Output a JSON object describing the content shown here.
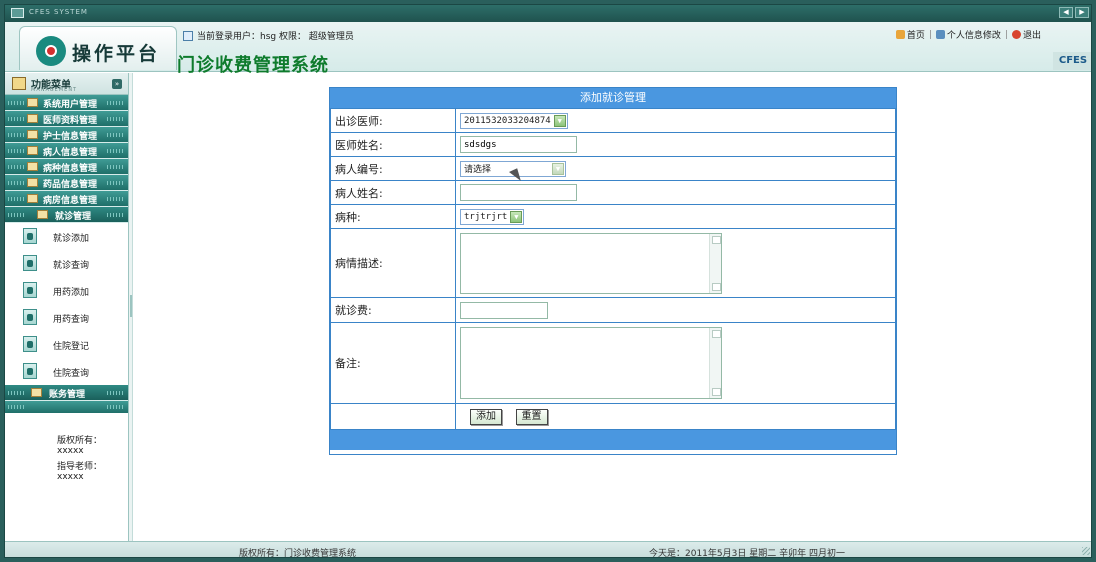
{
  "window": {
    "title": "CFES SYSTEM"
  },
  "header": {
    "logo_text": "操作平台",
    "system_title": "门诊收费管理系统",
    "user_label": "当前登录用户：hsg 权限： 超级管理员",
    "nav": {
      "home": "首页",
      "profile": "个人信息修改",
      "logout": "退出",
      "sep": "|"
    },
    "brand": "CFES"
  },
  "sidebar": {
    "menu_title": "功能菜单",
    "menu_subtitle": "MANAGEMENT",
    "groups": [
      {
        "label": "系统用户管理"
      },
      {
        "label": "医师资料管理"
      },
      {
        "label": "护士信息管理"
      },
      {
        "label": "病人信息管理"
      },
      {
        "label": "病种信息管理"
      },
      {
        "label": "药品信息管理"
      },
      {
        "label": "病房信息管理"
      }
    ],
    "active_group": "就诊管理",
    "sub_items": [
      {
        "label": "就诊添加"
      },
      {
        "label": "就诊查询"
      },
      {
        "label": "用药添加"
      },
      {
        "label": "用药查询"
      },
      {
        "label": "住院登记"
      },
      {
        "label": "住院查询"
      }
    ],
    "account_group": "账务管理",
    "copyright": "版权所有：xxxxx",
    "advisor": "指导老师：xxxxx"
  },
  "form": {
    "title": "添加就诊管理",
    "doctor_label": "出诊医师:",
    "doctor_value": "2011532033204874",
    "doctor_name_label": "医师姓名:",
    "doctor_name_value": "sdsdgs",
    "patient_no_label": "病人编号:",
    "patient_no_value": "请选择",
    "patient_name_label": "病人姓名:",
    "patient_name_value": "",
    "disease_label": "病种:",
    "disease_value": "trjtrjrt",
    "description_label": "病情描述:",
    "description_value": "",
    "fee_label": "就诊费:",
    "fee_value": "",
    "remark_label": "备注:",
    "remark_value": "",
    "add_button": "添加",
    "reset_button": "重置"
  },
  "statusbar": {
    "copyright": "版权所有：门诊收费管理系统",
    "date": "今天是：2011年5月3日 星期二 辛卯年 四月初一"
  },
  "colors": {
    "accent": "#4a97e0",
    "sidebar_teal": "#2f8a84",
    "title_green": "#0e7b2c"
  }
}
